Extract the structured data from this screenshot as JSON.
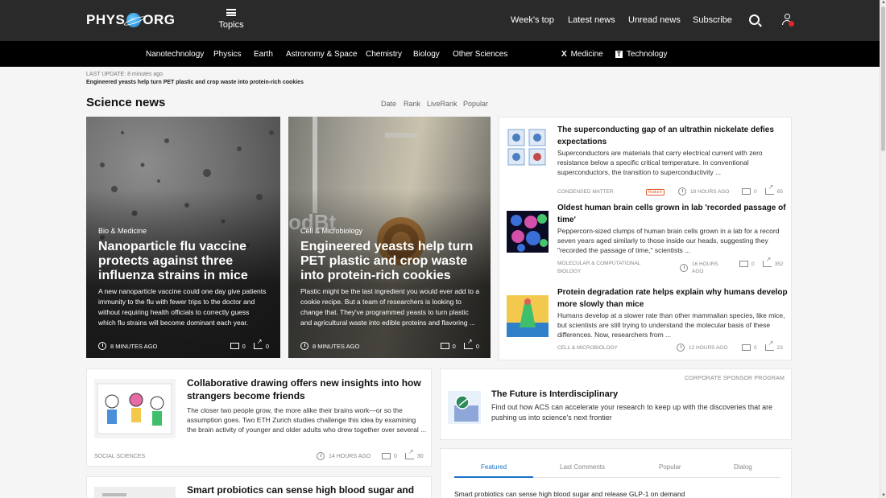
{
  "header": {
    "logo_left": "PHYS",
    "logo_right": "ORG",
    "topics_label": "Topics",
    "nav": [
      "Week's top",
      "Latest news",
      "Unread news",
      "Subscribe"
    ]
  },
  "subnav": {
    "items": [
      "Nanotechnology",
      "Physics",
      "Earth",
      "Astronomy & Space",
      "Chemistry",
      "Biology",
      "Other Sciences"
    ],
    "medicine_icon": "X",
    "medicine_label": "Medicine",
    "technology_icon": "T",
    "technology_label": "Technology"
  },
  "last_update": {
    "label": "LAST UPDATE: 8 minutes ago",
    "title": "Engineered yeasts help turn PET plastic and crop waste into protein-rich cookies"
  },
  "section": {
    "title": "Science news",
    "sort": [
      "Date",
      "Rank",
      "LiveRank",
      "Popular"
    ]
  },
  "hero": [
    {
      "category": "Bio & Medicine",
      "title": "Nanoparticle flu vaccine protects against three influenza strains in mice",
      "description": "A new nanoparticle vaccine could one day give patients immunity to the flu with fewer trips to the doctor and without requiring health officials to correctly guess which flu strains will become dominant each year.",
      "time": "8 MINUTES AGO",
      "comments": "0",
      "shares": "0"
    },
    {
      "category": "Cell & Microbiology",
      "title": "Engineered yeasts help turn PET plastic and crop waste into protein-rich cookies",
      "description": "Plastic might be the last ingredient you would ever add to a cookie recipe. But a team of researchers is looking to change that. They've programmed yeasts to turn plastic and agricultural waste into edible proteins and flavoring ...",
      "time": "8 MINUTES AGO",
      "comments": "0",
      "shares": "0"
    }
  ],
  "right_list": [
    {
      "title": "The superconducting gap of an ultrathin nickelate defies expectations",
      "description": "Superconductors are materials that carry electrical current with zero resistance below a specific critical temperature. In conventional superconductors, the transition to superconductivity ...",
      "category": "CONDENSED MATTER",
      "badge": "feature",
      "time": "18 HOURS AGO",
      "comments": "0",
      "shares": "65"
    },
    {
      "title": "Oldest human brain cells grown in lab 'recorded passage of time'",
      "description": "Peppercorn-sized clumps of human brain cells grown in a lab for a record seven years aged similarly to those inside our heads, suggesting they \"recorded the passage of time,\" scientists ...",
      "category": "MOLECULAR & COMPUTATIONAL BIOLOGY",
      "time": "16 HOURS AGO",
      "comments": "0",
      "shares": "352"
    },
    {
      "title": "Protein degradation rate helps explain why humans develop more slowly than mice",
      "description": "Humans develop at a slower rate than other mammalian species, like mice, but scientists are still trying to understand the molecular basis of these differences. Now, researchers from ...",
      "category": "CELL & MICROBIOLOGY",
      "time": "12 HOURS AGO",
      "comments": "0",
      "shares": "23"
    }
  ],
  "card1": {
    "title": "Collaborative drawing offers new insights into how strangers become friends",
    "description": "The closer two people grow, the more alike their brains work—or so the assumption goes. Two ETH Zurich studies challenge this idea by examining the brain activity of younger and older adults who drew together over several ...",
    "category": "SOCIAL SCIENCES",
    "time": "14 HOURS AGO",
    "comments": "0",
    "shares": "30"
  },
  "card2": {
    "title": "Smart probiotics can sense high blood sugar and"
  },
  "sponsor": {
    "label": "CORPORATE SPONSOR PROGRAM",
    "title": "The Future is Interdisciplinary",
    "description": "Find out how ACS can accelerate your research to keep up with the discoveries that are pushing us into science's next frontier"
  },
  "tabs": {
    "items": [
      "Featured",
      "Last Comments",
      "Popular",
      "Dialog"
    ],
    "first_item": "Smart probiotics can sense high blood sugar and release GLP-1 on demand"
  }
}
